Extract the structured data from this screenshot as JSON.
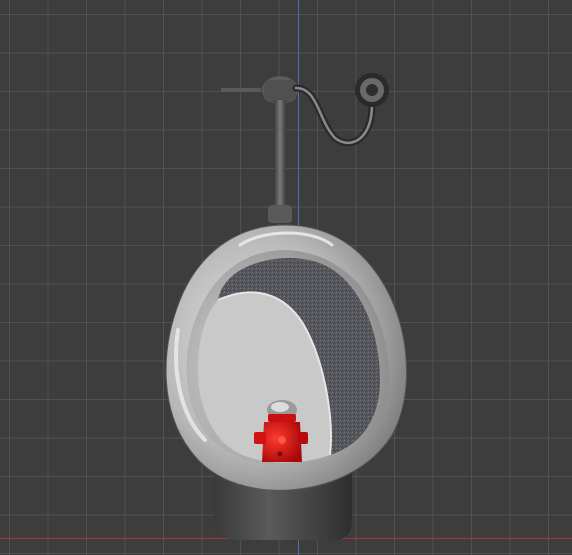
{
  "viewport": {
    "mode": "3d-viewport",
    "background_color": "#3d3d3d",
    "grid_color": "#555555",
    "y_axis_color": "#4a6fb0",
    "x_axis_color": "#a8343a"
  },
  "scene": {
    "objects": [
      {
        "name": "urinal",
        "icon": "urinal-icon",
        "color": "#bdbdbd"
      },
      {
        "name": "flush-valve",
        "icon": "flush-valve-icon",
        "color": "#5a5a5a"
      },
      {
        "name": "hydrant-toy",
        "icon": "fire-hydrant-icon",
        "color": "#e01010"
      }
    ]
  }
}
